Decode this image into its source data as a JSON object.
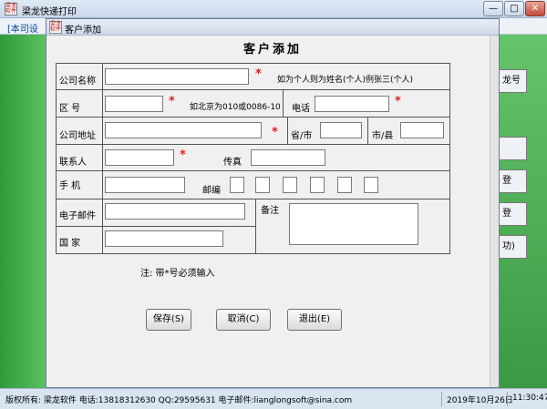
{
  "app": {
    "title": "梁龙快递打印",
    "icon_text": "梁龙软件",
    "menubar_first": "[本司设",
    "min_label": "—",
    "max_label": "□",
    "close_label": "✕",
    "right_buttons": [
      "龙号",
      "",
      "登",
      "登",
      "功)"
    ]
  },
  "status": {
    "copyright": "版权所有: 梁龙软件 电话:13818312630 QQ:29595631 电子邮件:lianglongsoft@sina.com",
    "date": "2019年10月26日",
    "time": "11:30:47"
  },
  "dialog": {
    "title": "客户添加",
    "icon_text": "梁龙软件",
    "heading": "客户添加",
    "labels": {
      "company_name": "公司名称",
      "area_code": "区    号",
      "phone": "电话",
      "company_address": "公司地址",
      "province": "省/市",
      "city": "市/县",
      "contact": "联系人",
      "fax": "传真",
      "mobile": "手    机",
      "postcode": "邮编",
      "email": "电子邮件",
      "remark": "备注",
      "country": "国    家"
    },
    "hints": {
      "company_name": "如为个人则为姓名(个人)例张三(个人)",
      "area_code": "如北京为010或0086-10"
    },
    "required_mark": "*",
    "footnote": "注: 带*号必须输入",
    "buttons": {
      "save": "保存(S)",
      "cancel": "取消(C)",
      "exit": "退出(E)"
    },
    "values": {
      "company_name": "",
      "area_code": "",
      "phone": "",
      "company_address": "",
      "province": "",
      "city": "",
      "contact": "",
      "fax": "",
      "mobile": "",
      "email": "",
      "country": "",
      "remark": ""
    }
  }
}
